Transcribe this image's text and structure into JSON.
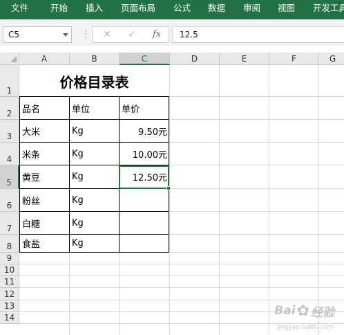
{
  "menu": {
    "items": [
      "文件",
      "开始",
      "插入",
      "页面布局",
      "公式",
      "数据",
      "审阅",
      "视图",
      "开发工具"
    ]
  },
  "formula_bar": {
    "name_box": "C5",
    "cancel_icon": "✕",
    "enter_icon": "✓",
    "fx_label": "fx",
    "value": "12.5"
  },
  "columns": [
    "A",
    "B",
    "C",
    "D",
    "E",
    "F",
    "G"
  ],
  "selected_column": "C",
  "rows": [
    "1",
    "2",
    "3",
    "4",
    "5",
    "6",
    "7",
    "8",
    "9",
    "10",
    "11",
    "12",
    "13",
    "14"
  ],
  "selected_row": "5",
  "sheet": {
    "title": "价格目录表",
    "headers": [
      "品名",
      "单位",
      "单价"
    ],
    "items": [
      {
        "name": "大米",
        "unit": "Kg",
        "price": "9.50元"
      },
      {
        "name": "米条",
        "unit": "Kg",
        "price": "10.00元"
      },
      {
        "name": "黄豆",
        "unit": "Kg",
        "price": "12.50元"
      },
      {
        "name": "粉丝",
        "unit": "Kg",
        "price": ""
      },
      {
        "name": "白糖",
        "unit": "Kg",
        "price": ""
      },
      {
        "name": "食盐",
        "unit": "Kg",
        "price": ""
      }
    ]
  },
  "watermark": {
    "brand": "Bai",
    "brand2": "经验",
    "sub": "jingyan.baidu.com"
  },
  "colors": {
    "accent": "#217346",
    "selection_fill_header": "#d2d2d2"
  }
}
